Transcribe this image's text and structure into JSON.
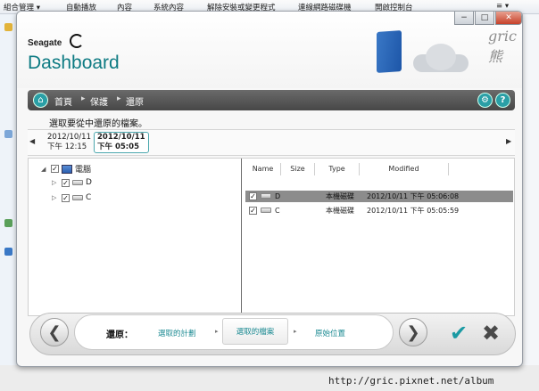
{
  "background": {
    "menubar": [
      "組合管理 ▾",
      "自動播放",
      "內容",
      "系統內容",
      "解除安裝或變更程式",
      "連線網路磁碟機",
      "開啟控制台"
    ],
    "menu_icon": "≡ ▾"
  },
  "dialog": {
    "brand": "Seagate",
    "title": "Dashboard",
    "watermark": "gric 熊",
    "window_buttons": {
      "minimize": "−",
      "maximize": "□",
      "close": "✕"
    }
  },
  "nav": {
    "breadcrumb": [
      "首頁",
      "保護",
      "還原"
    ],
    "separator": "▸",
    "gear": "⚙",
    "help": "?"
  },
  "instruction": "選取要從中還原的檔案。",
  "timeline": {
    "prev": "◀",
    "next": "▶",
    "items": [
      {
        "date": "2012/10/11",
        "time": "下午 12:15"
      },
      {
        "date": "2012/10/11",
        "time": "下午 05:05"
      }
    ]
  },
  "tree": {
    "root": "電腦",
    "children": [
      "D",
      "C"
    ]
  },
  "file_list": {
    "columns": [
      "Name",
      "Size",
      "Type",
      "Modified"
    ],
    "rows": [
      {
        "name": "D",
        "size": "",
        "type": "本機磁碟",
        "modified": "2012/10/11 下午 05:06:08"
      },
      {
        "name": "C",
        "size": "",
        "type": "本機磁碟",
        "modified": "2012/10/11 下午 05:05:59"
      }
    ]
  },
  "wizard": {
    "label": "還原：",
    "steps": [
      "選取的計劃",
      "選取的檔案",
      "原始位置"
    ],
    "back": "❮",
    "forward": "❯",
    "ok": "✔",
    "cancel": "✖"
  },
  "footer": "http://gric.pixnet.net/album"
}
